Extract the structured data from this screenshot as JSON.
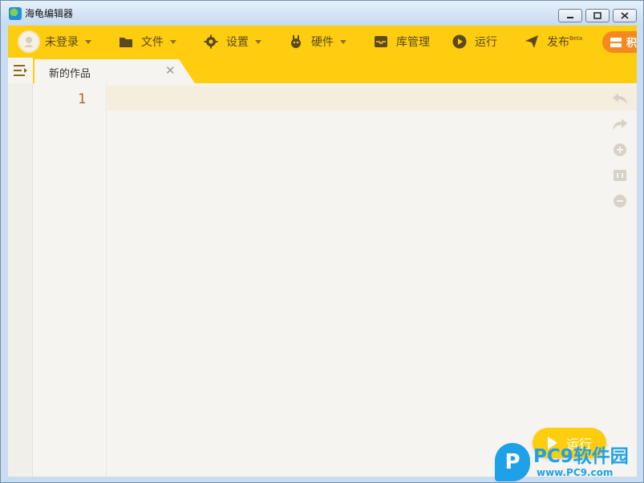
{
  "window": {
    "title": "海龟编辑器"
  },
  "toolbar": {
    "user_label": "未登录",
    "file_label": "文件",
    "settings_label": "设置",
    "hardware_label": "硬件",
    "library_label": "库管理",
    "run_label": "运行",
    "publish_label": "发布",
    "publish_badge": "Beta",
    "extra_label": "积"
  },
  "tabs": [
    {
      "label": "新的作品"
    }
  ],
  "editor": {
    "line_numbers": [
      "1"
    ]
  },
  "run_button": {
    "label": "运行"
  },
  "watermark": {
    "brand": "PC9软件园",
    "url": "www.PC9.com"
  },
  "colors": {
    "accent": "#fecd0f",
    "orange": "#f5881f",
    "line_number": "#b5642a",
    "watermark": "#1ea1e8"
  },
  "icons": [
    "user-avatar-icon",
    "folder-icon",
    "gear-icon",
    "hardware-icon",
    "inbox-icon",
    "play-icon",
    "send-icon",
    "undo-icon",
    "redo-icon",
    "zoom-in-icon",
    "fit-icon",
    "zoom-out-icon",
    "menu-icon",
    "close-icon"
  ]
}
